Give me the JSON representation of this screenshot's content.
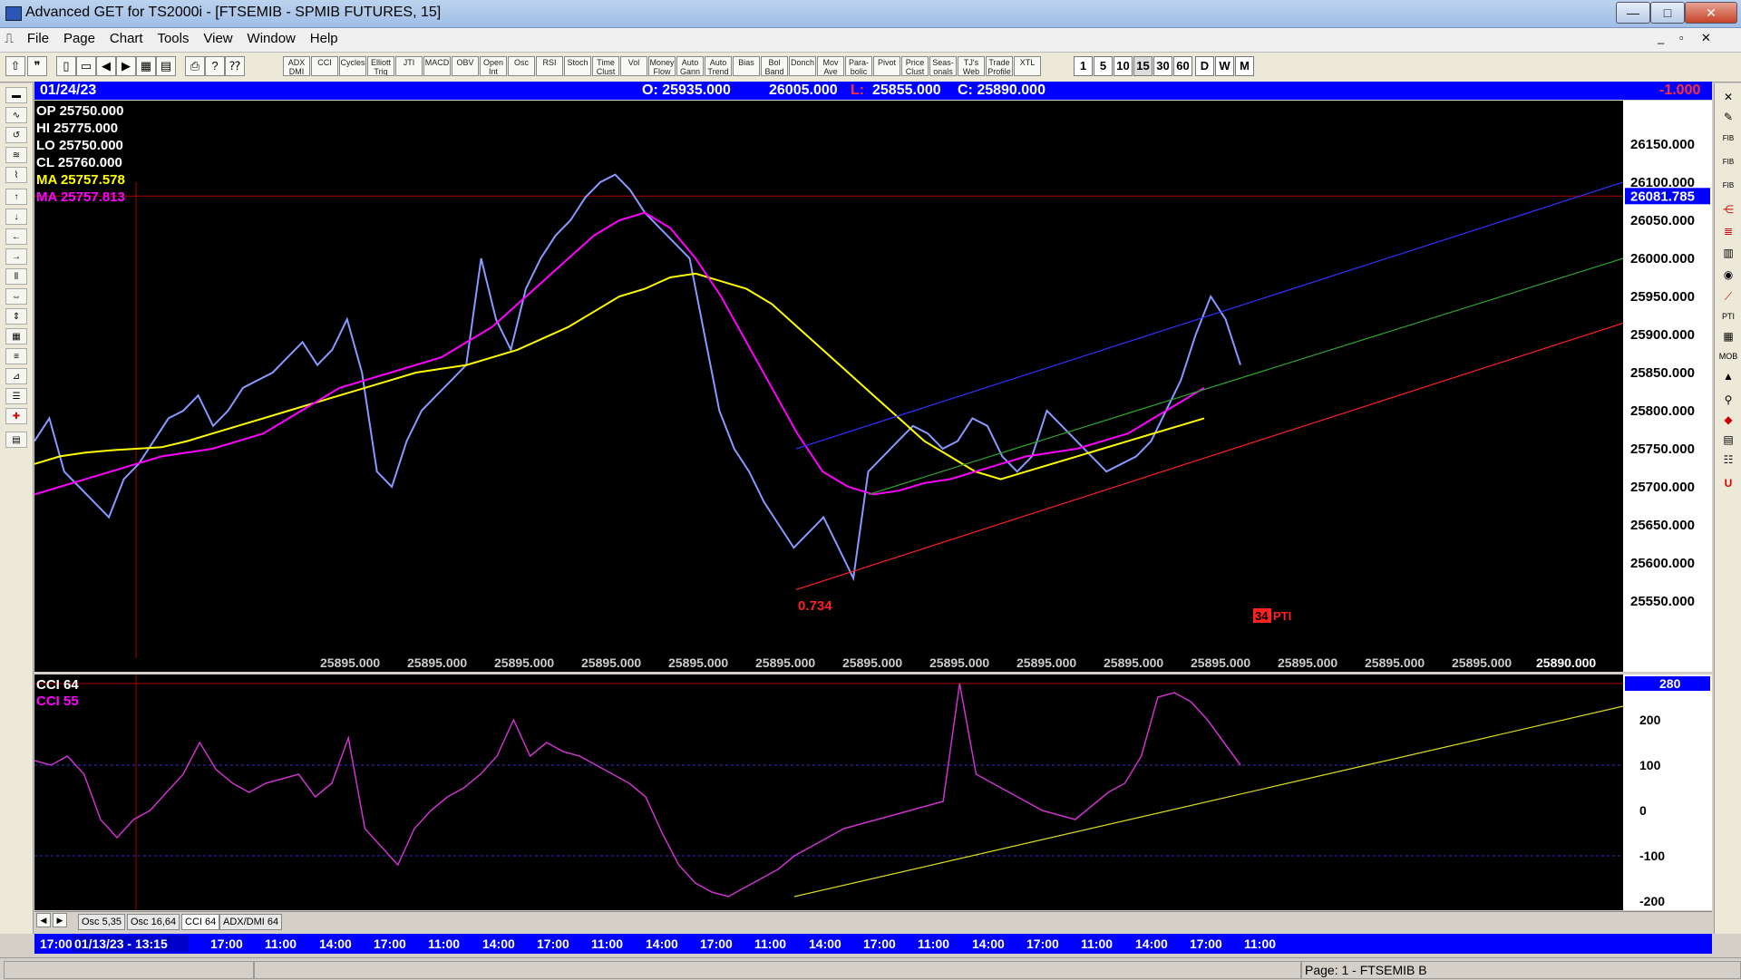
{
  "window": {
    "title": "Advanced GET for TS2000i - [FTSEMIB - SPMIB FUTURES, 15]",
    "minimize": "—",
    "maximize": "□",
    "close": "✕"
  },
  "menu": [
    "File",
    "Page",
    "Chart",
    "Tools",
    "View",
    "Window",
    "Help"
  ],
  "toolbar": {
    "study_buttons": [
      "ADX DMI",
      "CCI",
      "Cycles",
      "Elliott Trig",
      "JTI",
      "MACD",
      "OBV",
      "Open Int",
      "Osc",
      "RSI",
      "Stoch",
      "Time Clust",
      "Vol",
      "Money Flow",
      "Auto Gann",
      "Auto Trend",
      "Bias",
      "Bol Band",
      "Donch",
      "Mov Ave",
      "Para-bolic",
      "Pivot",
      "Price Clust",
      "Seas-onals",
      "TJ's Web",
      "Trade Profile",
      "XTL"
    ],
    "timeframes": [
      "1",
      "5",
      "10",
      "15",
      "30",
      "60",
      "D",
      "W",
      "M"
    ],
    "selected_timeframe": "15"
  },
  "infobar": {
    "date": "01/24/23",
    "open": "O: 25935.000",
    "high": "26005.000",
    "low_label": "L:",
    "low": "25855.000",
    "close": "C: 25890.000",
    "change": "-1.000"
  },
  "main_chart": {
    "legend": [
      {
        "label": "OP",
        "value": "25750.000",
        "color": "#ffffff"
      },
      {
        "label": "HI",
        "value": "25775.000",
        "color": "#ffffff"
      },
      {
        "label": "LO",
        "value": "25750.000",
        "color": "#ffffff"
      },
      {
        "label": "CL",
        "value": "25760.000",
        "color": "#ffffff"
      },
      {
        "label": "MA",
        "value": "25757.578",
        "color": "#ffff00"
      },
      {
        "label": "MA",
        "value": "25757.813",
        "color": "#ff00ff"
      }
    ],
    "price_ticks": [
      "26150.000",
      "26100.000",
      "26050.000",
      "26000.000",
      "25950.000",
      "25900.000",
      "25850.000",
      "25800.000",
      "25750.000",
      "25700.000",
      "25650.000",
      "25600.000",
      "25550.000"
    ],
    "highlight_price": "26081.785",
    "bottom_values": [
      "25895.000",
      "25895.000",
      "25895.000",
      "25895.000",
      "25895.000",
      "25895.000",
      "25895.000",
      "25895.000",
      "25895.000",
      "25895.000",
      "25895.000",
      "25895.000",
      "25895.000",
      "25895.000"
    ],
    "last_value": "25890.000",
    "ratio_label": "0.734",
    "pti_value": "34",
    "pti_label": "PTI"
  },
  "chart_data": {
    "type": "line",
    "title": "FTSEMIB - SPMIB FUTURES, 15",
    "ylim": [
      25500,
      26200
    ],
    "x_ticks": [
      "17:00",
      "01/13/23 - 13:15",
      "17:00",
      "11:00",
      "14:00",
      "17:00",
      "11:00",
      "14:00",
      "17:00",
      "11:00",
      "14:00",
      "17:00",
      "11:00",
      "14:00",
      "17:00",
      "11:00",
      "14:00",
      "17:00",
      "11:00",
      "14:00",
      "17:00",
      "11:00"
    ],
    "series": [
      {
        "name": "Price",
        "color": "#8899ff",
        "values": [
          25760,
          25790,
          25720,
          25700,
          25680,
          25660,
          25710,
          25730,
          25760,
          25790,
          25800,
          25820,
          25780,
          25800,
          25830,
          25840,
          25850,
          25870,
          25890,
          25860,
          25880,
          25920,
          25850,
          25720,
          25700,
          25760,
          25800,
          25820,
          25840,
          25860,
          26000,
          25920,
          25880,
          25960,
          26000,
          26030,
          26050,
          26080,
          26100,
          26110,
          26090,
          26060,
          26040,
          26020,
          26000,
          25900,
          25800,
          25750,
          25720,
          25680,
          25650,
          25620,
          25640,
          25660,
          25620,
          25580,
          25720,
          25740,
          25760,
          25780,
          25770,
          25750,
          25760,
          25790,
          25780,
          25740,
          25720,
          25740,
          25800,
          25780,
          25760,
          25740,
          25720,
          25730,
          25740,
          25760,
          25800,
          25840,
          25900,
          25950,
          25920,
          25860
        ]
      },
      {
        "name": "MA",
        "color": "#ffff00",
        "values": [
          25730,
          25740,
          25745,
          25748,
          25750,
          25752,
          25760,
          25770,
          25780,
          25790,
          25800,
          25810,
          25820,
          25830,
          25840,
          25850,
          25855,
          25860,
          25870,
          25880,
          25895,
          25910,
          25930,
          25950,
          25960,
          25975,
          25980,
          25970,
          25960,
          25940,
          25910,
          25880,
          25850,
          25820,
          25790,
          25760,
          25740,
          25720,
          25710,
          25720,
          25730,
          25740,
          25750,
          25760,
          25770,
          25780,
          25790
        ]
      },
      {
        "name": "MA",
        "color": "#ff00ff",
        "values": [
          25690,
          25700,
          25710,
          25720,
          25730,
          25740,
          25745,
          25750,
          25760,
          25770,
          25790,
          25810,
          25830,
          25840,
          25850,
          25860,
          25870,
          25890,
          25910,
          25940,
          25970,
          26000,
          26030,
          26050,
          26060,
          26040,
          26000,
          25950,
          25890,
          25830,
          25770,
          25720,
          25700,
          25690,
          25695,
          25705,
          25710,
          25720,
          25730,
          25740,
          25745,
          25750,
          25760,
          25770,
          25790,
          25810,
          25830
        ]
      }
    ],
    "sub_chart": {
      "name": "CCI 64",
      "second_name": "CCI 55",
      "ylim": [
        -200,
        280
      ],
      "ticks": [
        "280",
        "200",
        "100",
        "0",
        "-100",
        "-200"
      ],
      "values": [
        110,
        100,
        120,
        80,
        -20,
        -60,
        -20,
        0,
        40,
        80,
        150,
        90,
        60,
        40,
        60,
        70,
        80,
        30,
        60,
        160,
        -40,
        -80,
        -120,
        -40,
        0,
        30,
        50,
        80,
        120,
        200,
        120,
        150,
        130,
        120,
        100,
        80,
        60,
        30,
        -50,
        -120,
        -160,
        -180,
        -190,
        -170,
        -150,
        -130,
        -100,
        -80,
        -60,
        -40,
        -30,
        -20,
        -10,
        0,
        10,
        20,
        280,
        80,
        60,
        40,
        20,
        0,
        -10,
        -20,
        10,
        40,
        60,
        120,
        250,
        260,
        240,
        200,
        150,
        100
      ]
    }
  },
  "sub_chart": {
    "label1": "CCI 64",
    "label2": "CCI 55",
    "highlight_value": "280"
  },
  "tabs": [
    "Osc 5,35",
    "Osc 16,64",
    "CCI 64",
    "ADX/DMI 64"
  ],
  "active_tab": "CCI 64",
  "time_axis": [
    "17:00",
    "01/13/23 - 13:15",
    "17:00",
    "11:00",
    "14:00",
    "17:00",
    "11:00",
    "14:00",
    "17:00",
    "11:00",
    "14:00",
    "17:00",
    "11:00",
    "14:00",
    "17:00",
    "11:00",
    "14:00",
    "17:00",
    "11:00",
    "14:00",
    "17:00",
    "11:00"
  ],
  "status": {
    "page": "Page: 1 - FTSEMIB B"
  }
}
